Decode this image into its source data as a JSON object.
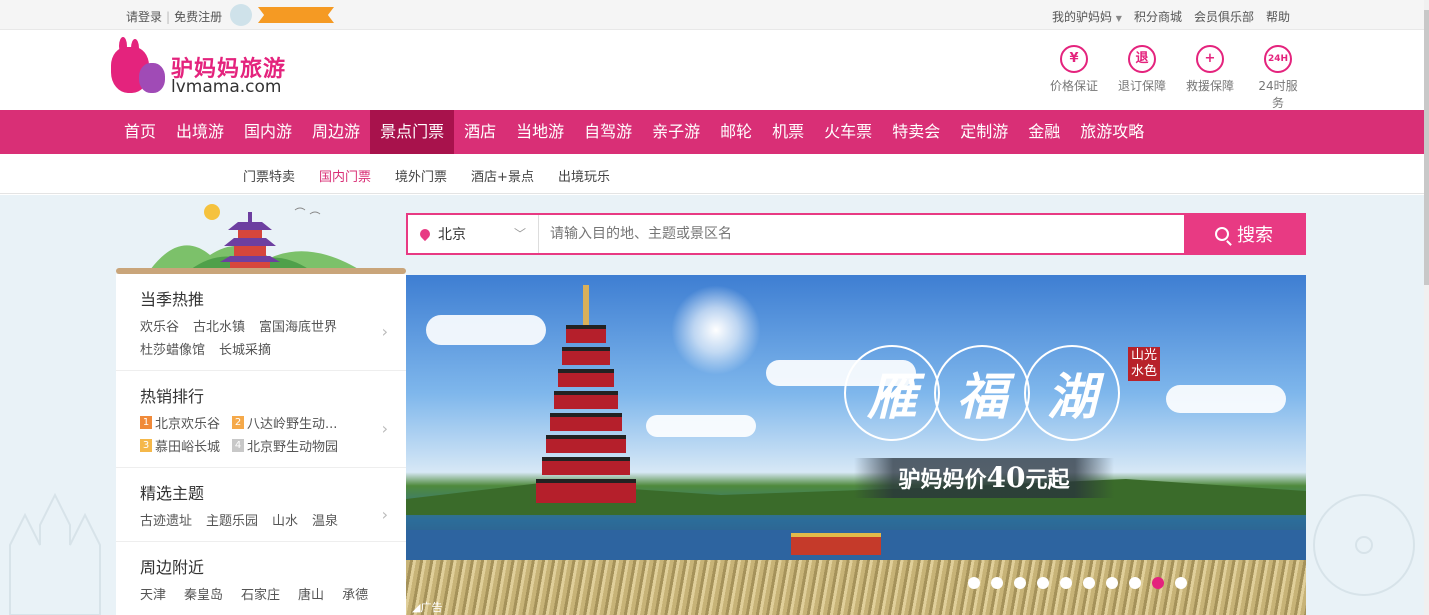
{
  "topbar": {
    "login": "请登录",
    "register": "免费注册",
    "my_account": "我的驴妈妈",
    "points_mall": "积分商城",
    "club": "会员俱乐部",
    "help": "帮助"
  },
  "logo": {
    "cn": "驴妈妈旅游",
    "en": "lvmama.com"
  },
  "guarantees": [
    {
      "icon": "yen-icon",
      "glyph": "¥",
      "label": "价格保证"
    },
    {
      "icon": "refund-icon",
      "glyph": "退",
      "label": "退订保障"
    },
    {
      "icon": "rescue-icon",
      "glyph": "+",
      "label": "救援保障"
    },
    {
      "icon": "24h-icon",
      "glyph": "24H",
      "label": "24时服务"
    }
  ],
  "main_nav": [
    "首页",
    "出境游",
    "国内游",
    "周边游",
    "景点门票",
    "酒店",
    "当地游",
    "自驾游",
    "亲子游",
    "邮轮",
    "机票",
    "火车票",
    "特卖会",
    "定制游",
    "金融",
    "旅游攻略"
  ],
  "sub_nav": [
    "门票特卖",
    "国内门票",
    "境外门票",
    "酒店+景点",
    "出境玩乐"
  ],
  "search": {
    "city": "北京",
    "placeholder": "请输入目的地、主题或景区名",
    "button": "搜索"
  },
  "left_panel": {
    "seasonal": {
      "title": "当季热推",
      "links": [
        "欢乐谷",
        "古北水镇",
        "富国海底世界",
        "杜莎蜡像馆",
        "长城采摘"
      ]
    },
    "hot": {
      "title": "热销排行",
      "ranks": [
        {
          "n": "1",
          "name": "北京欢乐谷",
          "color": "#f08a3a"
        },
        {
          "n": "2",
          "name": "八达岭野生动...",
          "color": "#f5a94a"
        },
        {
          "n": "3",
          "name": "慕田峪长城",
          "color": "#f5b84a"
        },
        {
          "n": "4",
          "name": "北京野生动物园",
          "color": "#c8c8c8"
        }
      ]
    },
    "themes": {
      "title": "精选主题",
      "links": [
        "古迹遗址",
        "主题乐园",
        "山水",
        "温泉"
      ]
    },
    "nearby": {
      "title": "周边附近",
      "links": [
        "天津",
        "秦皇岛",
        "石家庄",
        "唐山",
        "承德"
      ]
    }
  },
  "banner": {
    "title_chars": [
      "雁",
      "福",
      "湖"
    ],
    "seal": "山光水色",
    "price_prefix": "驴妈妈价",
    "price": "40",
    "price_suffix": "元起",
    "ad_label": "广告",
    "dots_total": 10,
    "dot_active": 9
  },
  "colors": {
    "brand": "#d92f76",
    "accent": "#e83a83",
    "nav_active": "#a8124c"
  }
}
